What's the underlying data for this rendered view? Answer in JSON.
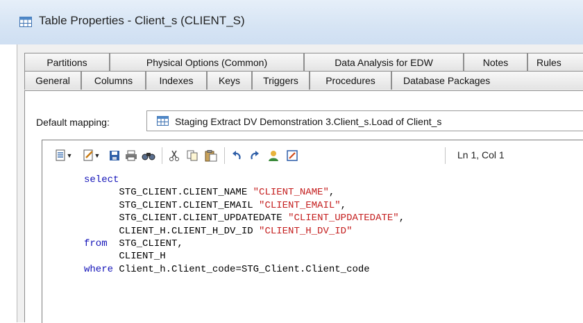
{
  "window": {
    "title": "Table Properties - Client_s (CLIENT_S)",
    "icon": "table-grid-icon"
  },
  "tabs": {
    "back_row": [
      "Partitions",
      "Physical Options (Common)",
      "Data Analysis for EDW",
      "Notes",
      "Rules"
    ],
    "front_row": [
      "General",
      "Columns",
      "Indexes",
      "Keys",
      "Triggers",
      "Procedures",
      "Database Packages"
    ]
  },
  "mapping": {
    "label": "Default mapping:",
    "value": "Staging Extract DV Demonstration 3.Client_s.Load of Client_s",
    "icon": "table-grid-icon"
  },
  "toolbar": {
    "items": [
      "edit-menu-icon",
      "properties-menu-icon",
      "save-icon",
      "print-icon",
      "find-icon",
      "cut-icon",
      "copy-icon",
      "paste-icon",
      "undo-icon",
      "redo-icon",
      "user-icon",
      "edit-icon"
    ],
    "position_text": "Ln 1, Col 1"
  },
  "code": {
    "lines": [
      [
        {
          "t": "select",
          "c": "kw"
        }
      ],
      [
        {
          "t": "      STG_CLIENT.CLIENT_NAME "
        },
        {
          "t": "\"CLIENT_NAME\"",
          "c": "str"
        },
        {
          "t": ","
        }
      ],
      [
        {
          "t": "      STG_CLIENT.CLIENT_EMAIL "
        },
        {
          "t": "\"CLIENT_EMAIL\"",
          "c": "str"
        },
        {
          "t": ","
        }
      ],
      [
        {
          "t": "      STG_CLIENT.CLIENT_UPDATEDATE "
        },
        {
          "t": "\"CLIENT_UPDATEDATE\"",
          "c": "str"
        },
        {
          "t": ","
        }
      ],
      [
        {
          "t": "      CLIENT_H.CLIENT_H_DV_ID "
        },
        {
          "t": "\"CLIENT_H_DV_ID\"",
          "c": "str"
        }
      ],
      [
        {
          "t": "from",
          "c": "kw"
        },
        {
          "t": "  STG_CLIENT,"
        }
      ],
      [
        {
          "t": "      CLIENT_H"
        }
      ],
      [
        {
          "t": "where",
          "c": "kw"
        },
        {
          "t": " Client_h.Client_code=STG_Client.Client_code"
        }
      ]
    ]
  },
  "colors": {
    "keyword": "#1212b8",
    "string": "#c41e1e",
    "titlebar": "#d6e4f4",
    "dialog_bg": "#f0f0f0"
  }
}
